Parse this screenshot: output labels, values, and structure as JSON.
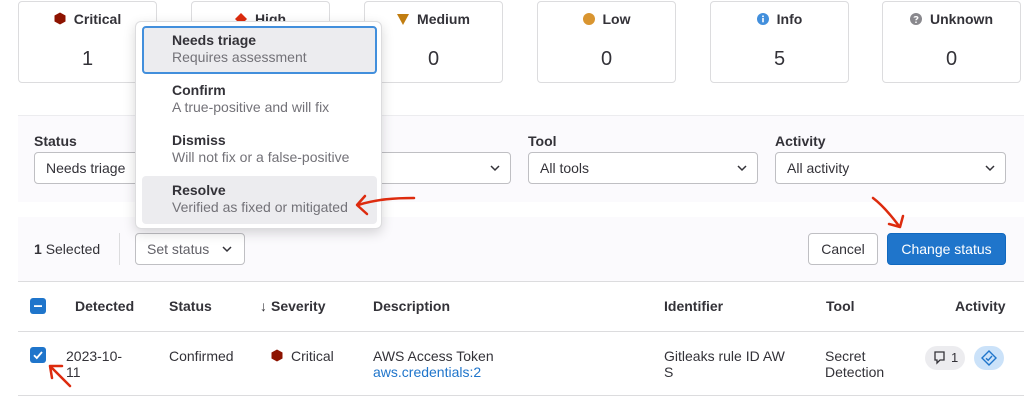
{
  "severity_cards": [
    {
      "label": "Critical",
      "count": "1",
      "color": "#8d1300",
      "icon": "critical-hexagon-icon"
    },
    {
      "label": "High",
      "count": "",
      "color": "#dd2b0e",
      "icon": "high-diamond-icon"
    },
    {
      "label": "Medium",
      "count": "0",
      "color": "#c17d10",
      "icon": "medium-triangle-icon"
    },
    {
      "label": "Low",
      "count": "0",
      "color": "#d99530",
      "icon": "low-circle-icon"
    },
    {
      "label": "Info",
      "count": "5",
      "color": "#428fdc",
      "icon": "info-circle-icon"
    },
    {
      "label": "Unknown",
      "count": "0",
      "color": "#89888d",
      "icon": "unknown-question-icon"
    }
  ],
  "filters": {
    "status_label": "Status",
    "status_value": "Needs triage",
    "tool_label": "Tool",
    "tool_value": "All tools",
    "activity_label": "Activity",
    "activity_value": "All activity"
  },
  "dropdown": {
    "items": [
      {
        "title": "Needs triage",
        "description": "Requires assessment"
      },
      {
        "title": "Confirm",
        "description": "A true-positive and will fix"
      },
      {
        "title": "Dismiss",
        "description": "Will not fix or a false-positive"
      },
      {
        "title": "Resolve",
        "description": "Verified as fixed or mitigated"
      }
    ]
  },
  "actions": {
    "selected_count": "1",
    "selected_label": "Selected",
    "set_status": "Set status",
    "cancel": "Cancel",
    "change_status": "Change status"
  },
  "table": {
    "headers": {
      "detected": "Detected",
      "status": "Status",
      "severity": "Severity",
      "sort_arrow": "↓",
      "description": "Description",
      "identifier": "Identifier",
      "tool": "Tool",
      "activity": "Activity"
    },
    "rows": [
      {
        "detected_line1": "2023-10-",
        "detected_line2": "11",
        "status": "Confirmed",
        "severity": "Critical",
        "description": "AWS Access Token",
        "location": "aws.credentials:2",
        "identifier_line1": "Gitleaks rule ID AW",
        "identifier_line2": "S",
        "tool_line1": "Secret",
        "tool_line2": "Detection",
        "comment_count": "1"
      }
    ]
  },
  "colors": {
    "accent": "#1f75cb",
    "annotation": "#dd2b0e"
  }
}
